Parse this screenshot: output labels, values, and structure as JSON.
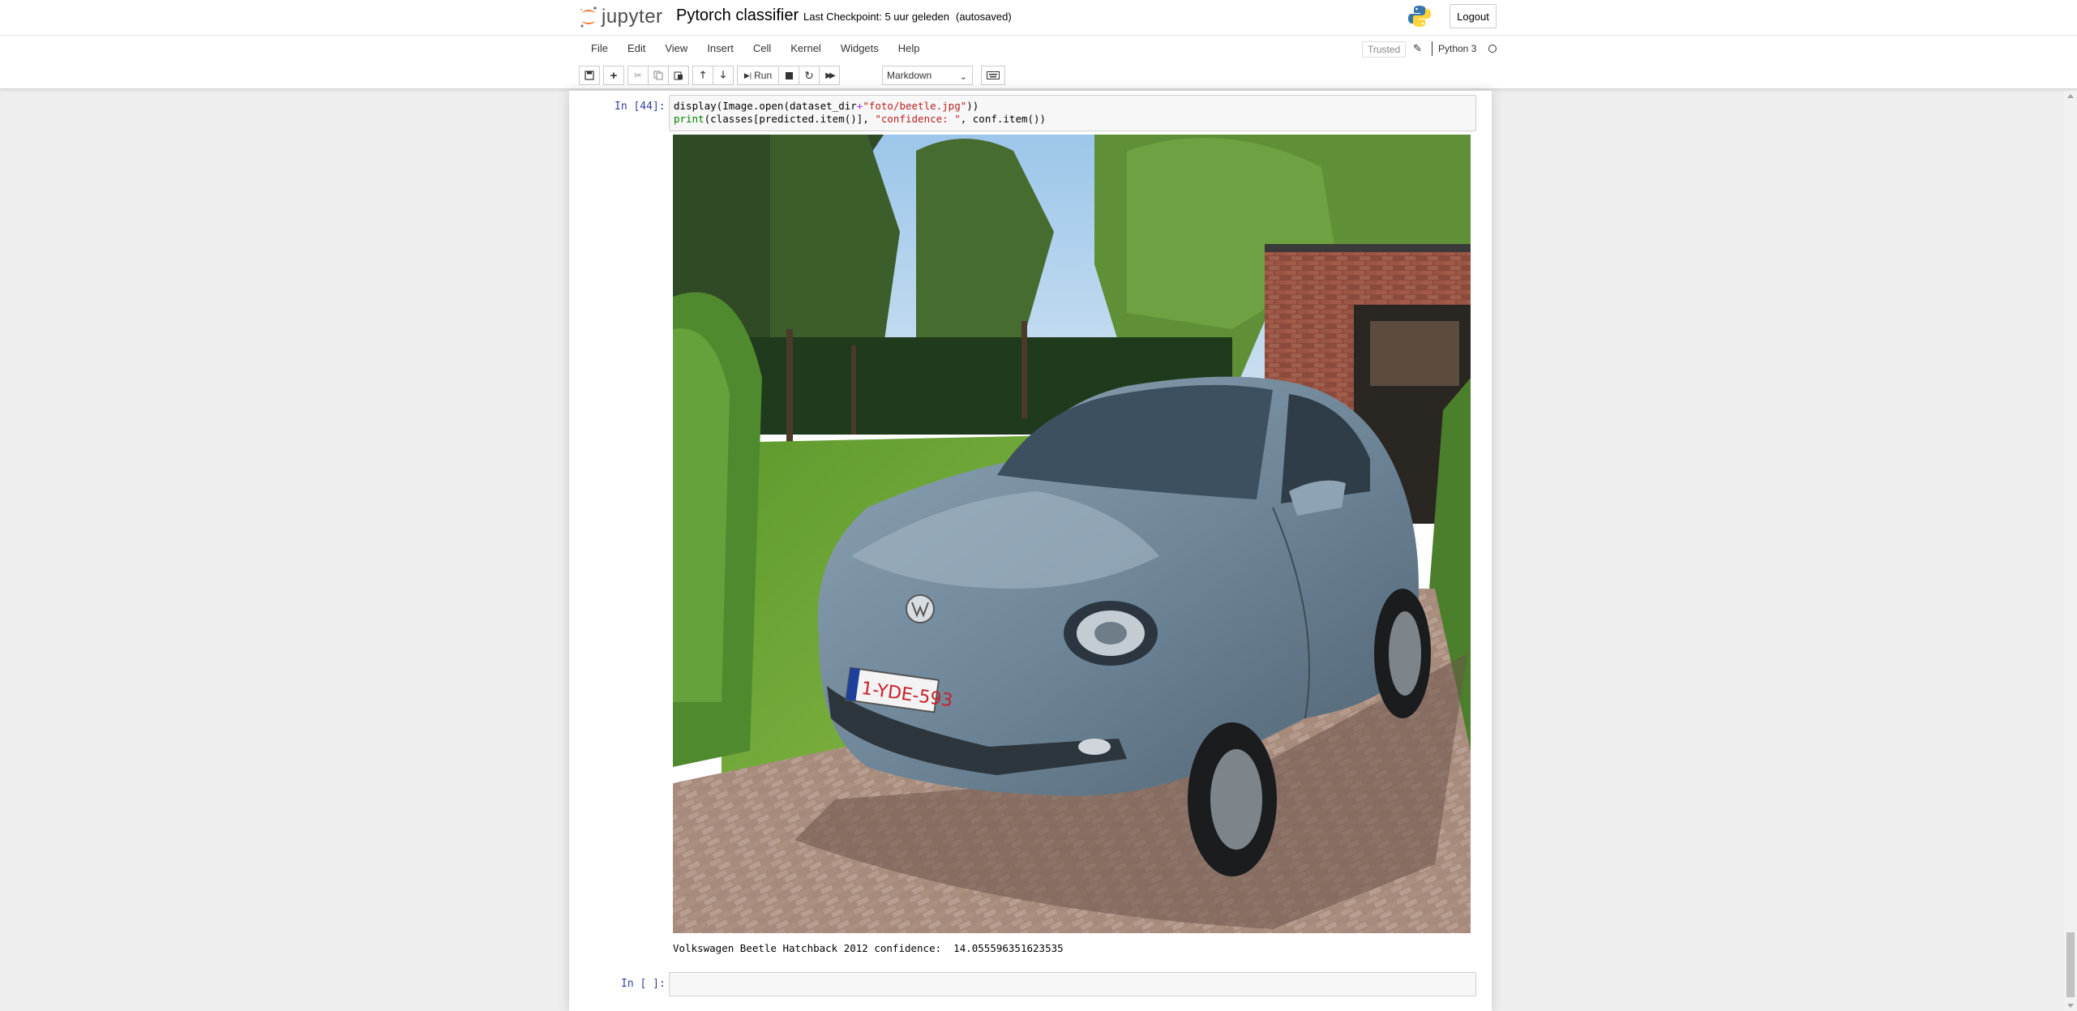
{
  "header": {
    "logo_text": "jupyter",
    "notebook_title": "Pytorch classifier",
    "checkpoint": "Last Checkpoint: 5 uur geleden",
    "autosave": "(autosaved)",
    "logout_label": "Logout"
  },
  "menubar": {
    "items": [
      "File",
      "Edit",
      "View",
      "Insert",
      "Cell",
      "Kernel",
      "Widgets",
      "Help"
    ],
    "trusted_label": "Trusted",
    "kernel_name": "Python 3"
  },
  "toolbar": {
    "run_label": "Run",
    "cell_type": "Markdown"
  },
  "cells": {
    "cell1": {
      "prompt": "In [44]:",
      "code_line1": {
        "a": "display(Image.open(dataset_dir",
        "op": "+",
        "str": "\"foto/beetle.jpg\"",
        "b": "))"
      },
      "code_line2": {
        "kw": "print",
        "a": "(classes[predicted.item()], ",
        "str": "\"confidence: \"",
        "b": ", conf.item())"
      },
      "output_text": "Volkswagen Beetle Hatchback 2012 confidence:  14.055596351623535"
    },
    "cell2": {
      "prompt": "In [ ]:"
    }
  },
  "colors": {
    "prompt": "#303f9f",
    "keyword": "#008000",
    "string": "#ba2121",
    "operator": "#aa22ff",
    "jupyter_orange": "#f37726"
  }
}
